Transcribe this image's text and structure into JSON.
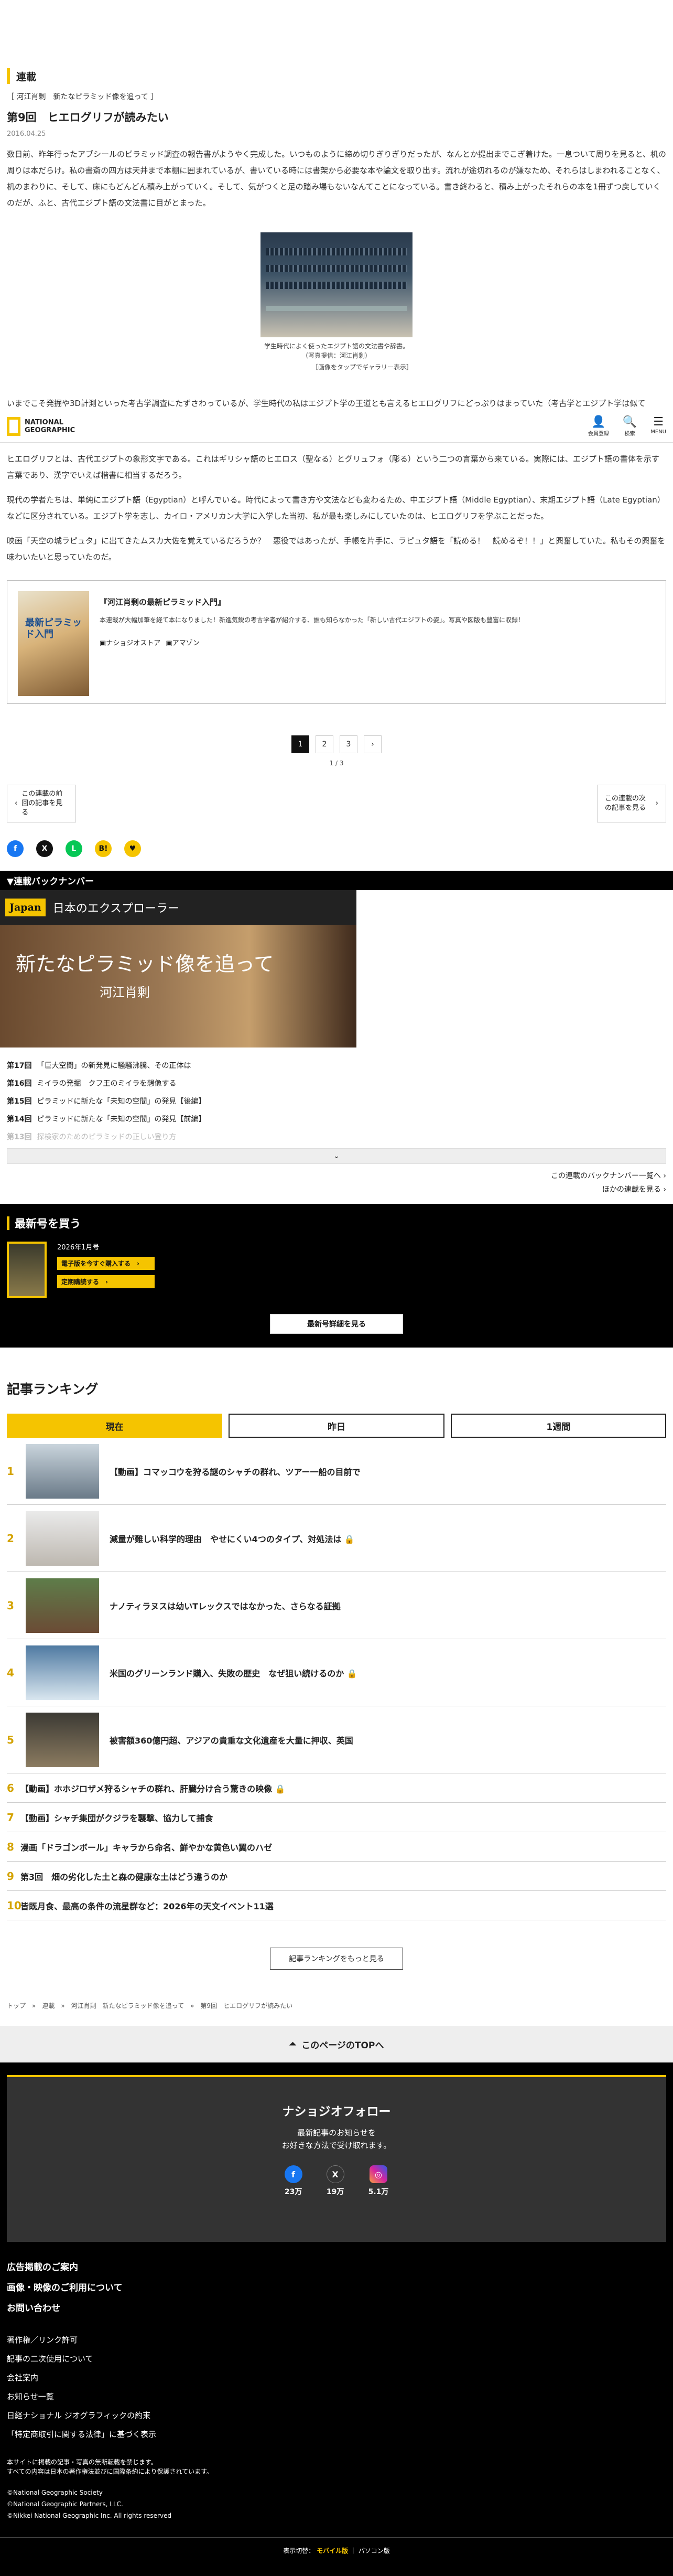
{
  "article": {
    "series_label": "連載",
    "series_name": "［ 河江肖剰　新たなピラミッド像を追って ］",
    "title": "第9回　ヒエログリフが読みたい",
    "date": "2016.04.25",
    "p1": "数日前、昨年行ったアブシールのピラミッド調査の報告書がようやく完成した。いつものように締め切りぎりぎりだったが、なんとか提出までこぎ着けた。一息ついて周りを見ると、机の周りは本だらけ。私の書斎の四方は天井まで本棚に囲まれているが、書いている時には書架から必要な本や論文を取り出す。流れが途切れるのが嫌なため、それらはしまわれることなく、机のまわりに、そして、床にもどんどん積み上がっていく。そして、気がつくと足の踏み場もないなんてことになっている。書き終わると、積み上がったそれらの本を1冊ずつ戻していくのだが、ふと、古代エジプト語の文法書に目がとまった。",
    "figure_caption_1": "学生時代によく使ったエジプト語の文法書や辞書。",
    "figure_caption_2": "（写真提供：河江肖剰）",
    "figure_link": "［画像をタップでギャラリー表示］",
    "p2": "いまでこそ発掘や3D計測といった考古学調査にたずさわっているが、学生時代の私はエジプト学の王道とも言えるヒエログリフにどっぷりはまっていた（考古学とエジプト学は似て",
    "p3": "ヒエログリフとは、古代エジプトの象形文字である。これはギリシャ語のヒエロス（聖なる）とグリュフォ（彫る）という二つの言葉から来ている。実際には、エジプト語の書体を示す言葉であり、漢字でいえば楷書に相当するだろう。",
    "p4": "現代の学者たちは、単純にエジプト語（Egyptian）と呼んでいる。時代によって書き方や文法なども変わるため、中エジプト語（Middle Egyptian）、末期エジプト語（Late Egyptian）などに区分されている。エジプト学を志し、カイロ・アメリカン大学に入学した当初、私が最も楽しみにしていたのは、ヒエログリフを学ぶことだった。",
    "p5": "映画「天空の城ラピュタ」に出てきたムスカ大佐を覚えているだろうか？　悪役ではあったが、手帳を片手に、ラピュタ語を「読める！　読めるぞ！！」と興奮していた。私もその興奮を味わいたいと思っていたのだ。"
  },
  "header": {
    "logo_line1": "NATIONAL",
    "logo_line2": "GEOGRAPHIC",
    "member": "会員登録",
    "search": "検索",
    "menu": "MENU"
  },
  "book": {
    "cover_text": "最新ピラミッド入門",
    "title": "『河江肖剰の最新ピラミッド入門』",
    "desc": "本連載が大幅加筆を経て本になりました！新進気鋭の考古学者が紹介する、誰も知らなかった「新しい古代エジプトの姿」。写真や図版も豊富に収録！",
    "link1": "ナショジオストア",
    "link2": "アマゾン"
  },
  "pager": {
    "pages": [
      "1",
      "2",
      "3"
    ],
    "next": "›",
    "count": "1 / 3"
  },
  "prevnext": {
    "prev": "この連載の前回の記事を見る",
    "next": "この連載の次の記事を見る"
  },
  "share": {
    "fb": "f",
    "x": "X",
    "line": "L",
    "hatena": "B!",
    "pocket": "♥"
  },
  "backnumbers": {
    "bar": "▼連載バックナンバー",
    "banner_badge": "Japan",
    "banner_title": "日本のエクスプローラー",
    "banner_main": "新たなピラミッド像を追って",
    "banner_sub": "河江肖剰",
    "items": [
      {
        "ep": "第17回",
        "title": "「巨大空間」の新発見に騒騒沸騰、その正体は"
      },
      {
        "ep": "第16回",
        "title": "ミイラの発掘　クフ王のミイラを想像する"
      },
      {
        "ep": "第15回",
        "title": "ピラミッドに新たな「未知の空間」の発見【後編】"
      },
      {
        "ep": "第14回",
        "title": "ピラミッドに新たな「未知の空間」の発見【前編】"
      },
      {
        "ep": "第13回",
        "title": "探検家のためのピラミッドの正しい登り方"
      }
    ],
    "more": "⌄",
    "link1": "この連載のバックナンバー一覧へ ›",
    "link2": "ほかの連載を見る ›"
  },
  "latest": {
    "title": "最新号を買う",
    "issue": "2026年1月号",
    "btn1": "電子版を今すぐ購入する　›",
    "btn2": "定期購読する　›",
    "detail": "最新号詳細を見る"
  },
  "ranking": {
    "title": "記事ランキング",
    "tabs": [
      "現在",
      "昨日",
      "1週間"
    ],
    "items": [
      {
        "n": "1",
        "t": "【動画】コマッコウを狩る謎のシャチの群れ、ツアー一船の目前で"
      },
      {
        "n": "2",
        "t": "減量が難しい科学的理由　やせにくい4つのタイプ、対処法は 🔒"
      },
      {
        "n": "3",
        "t": "ナノティラヌスは幼いTレックスではなかった、さらなる証拠"
      },
      {
        "n": "4",
        "t": "米国のグリーンランド購入、失敗の歴史　なぜ狙い続けるのか 🔒"
      },
      {
        "n": "5",
        "t": "被害額360億円超、アジアの貴重な文化遺産を大量に押収、英国"
      }
    ],
    "small": [
      {
        "n": "6",
        "t": "【動画】ホホジロザメ狩るシャチの群れ、肝臓分け合う驚きの映像 🔒"
      },
      {
        "n": "7",
        "t": "【動画】シャチ集団がクジラを襲撃、協力して捕食"
      },
      {
        "n": "8",
        "t": "漫画「ドラゴンボール」キャラから命名、鮮やかな黄色い翼のハゼ"
      },
      {
        "n": "9",
        "t": "第3回　畑の劣化した土と森の健康な土はどう違うのか"
      },
      {
        "n": "10",
        "t": "皆既月食、最高の条件の流星群など：2026年の天文イベント11選"
      }
    ],
    "more": "記事ランキングをもっと見る"
  },
  "breadcrumb": "トップ　»　連載　»　河江肖剰　新たなピラミッド像を追って　»　第9回　ヒエログリフが読みたい",
  "totop": "このページのTOPへ",
  "footer": {
    "follow_title": "ナショジオフォロー",
    "follow_text1": "最新記事のお知らせを",
    "follow_text2": "お好きな方法で受け取れます。",
    "fb_count": "23万",
    "x_count": "19万",
    "ig_count": "5.1万",
    "big": [
      "広告掲載のご案内",
      "画像・映像のご利用について",
      "お問い合わせ"
    ],
    "small": [
      "著作権／リンク許可",
      "記事の二次使用について",
      "会社案内",
      "お知らせ一覧",
      "日経ナショナル ジオグラフィックの約束",
      "「特定商取引に関する法律」に基づく表示"
    ],
    "note1": "本サイトに掲載の記事・写真の無断転載を禁じます。",
    "note2": "すべての内容は日本の著作権法並びに国際条約により保護されています。",
    "copy": [
      "©National Geographic Society",
      "©National Geographic Partners, LLC.",
      "©Nikkei National Geographic Inc. All rights reserved"
    ],
    "display_label": "表示切替：",
    "mobile": "モバイル版",
    "pc": "パソコン版"
  },
  "colors": {
    "accent": "#f5c400",
    "black": "#000000"
  }
}
